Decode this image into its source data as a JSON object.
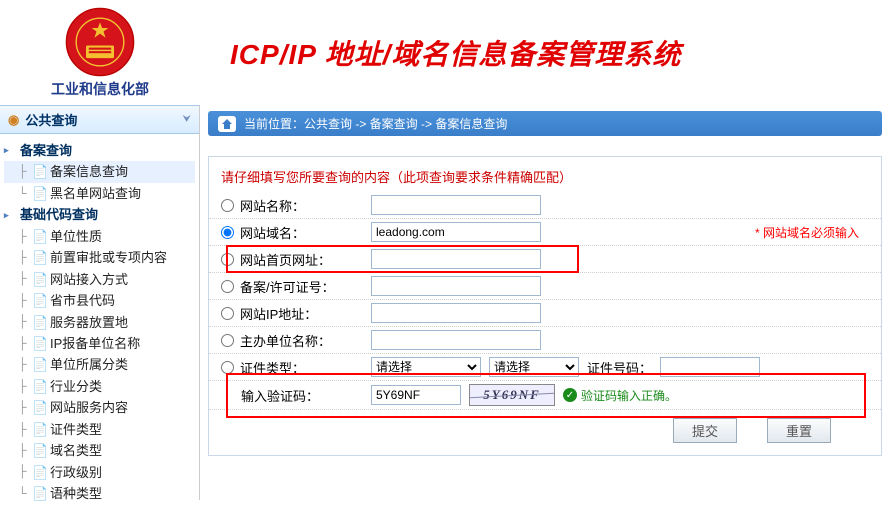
{
  "header": {
    "org_name": "工业和信息化部",
    "title": "ICP/IP 地址/域名信息备案管理系统"
  },
  "sidebar": {
    "title": "公共查询",
    "groups": [
      {
        "label": "备案查询",
        "items": [
          {
            "label": "备案信息查询",
            "selected": true
          },
          {
            "label": "黑名单网站查询"
          }
        ]
      },
      {
        "label": "基础代码查询",
        "items": [
          {
            "label": "单位性质"
          },
          {
            "label": "前置审批或专项内容"
          },
          {
            "label": "网站接入方式"
          },
          {
            "label": "省市县代码"
          },
          {
            "label": "服务器放置地"
          },
          {
            "label": "IP报备单位名称"
          },
          {
            "label": "单位所属分类"
          },
          {
            "label": "行业分类"
          },
          {
            "label": "网站服务内容"
          },
          {
            "label": "证件类型"
          },
          {
            "label": "域名类型"
          },
          {
            "label": "行政级别"
          },
          {
            "label": "语种类型"
          }
        ]
      }
    ]
  },
  "breadcrumb": {
    "prefix": "当前位置：",
    "parts": [
      "公共查询",
      "备案查询",
      "备案信息查询"
    ],
    "sep": " -> "
  },
  "form": {
    "instruction": "请仔细填写您所要查询的内容（此项查询要求条件精确匹配）",
    "rows": {
      "site_name": {
        "label": "网站名称："
      },
      "site_domain": {
        "label": "网站域名：",
        "value": "leadong.com",
        "hint": "* 网站域名必须输入"
      },
      "site_home": {
        "label": "网站首页网址："
      },
      "record_no": {
        "label": "备案/许可证号："
      },
      "site_ip": {
        "label": "网站IP地址："
      },
      "org_name": {
        "label": "主办单位名称："
      },
      "cert_type": {
        "label": "证件类型：",
        "select_placeholder": "请选择",
        "cert_no_label": "证件号码："
      },
      "captcha": {
        "label": "输入验证码：",
        "value": "5Y69NF",
        "captcha_text": "5Y69NF",
        "ok_text": "验证码输入正确。"
      }
    },
    "buttons": {
      "submit": "提交",
      "reset": "重置"
    }
  }
}
